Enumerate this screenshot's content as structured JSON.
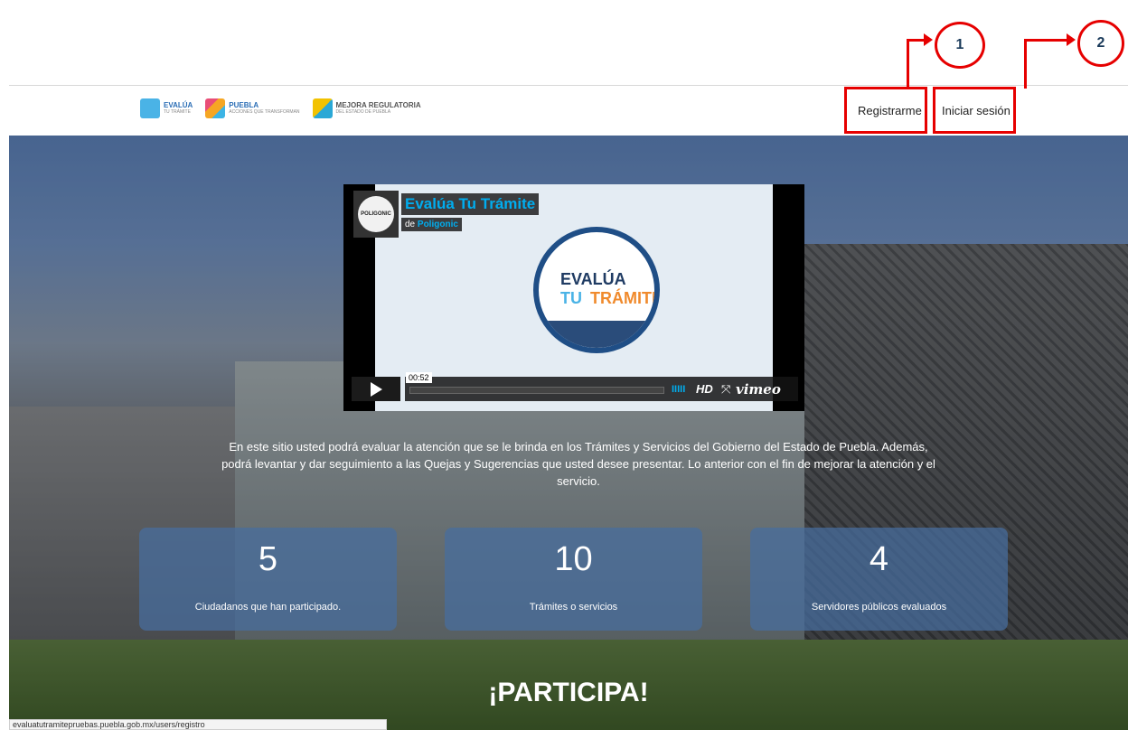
{
  "header": {
    "logos": [
      {
        "name": "evalua-tu-tramite",
        "line1": "EVALÚA",
        "line2": "TU TRÁMITE"
      },
      {
        "name": "puebla",
        "line1": "PUEBLA",
        "line2": "ACCIONES QUE TRANSFORMAN"
      },
      {
        "name": "mejora-regulatoria",
        "line1": "MEJORA REGULATORIA",
        "line2": "DEL ESTADO DE PUEBLA"
      }
    ],
    "nav": {
      "register_label": "Registrarme",
      "login_label": "Iniciar sesión"
    }
  },
  "annotations": {
    "marker1": "1",
    "marker2": "2",
    "color": "#e60000"
  },
  "video": {
    "title": "Evalúa Tu Trámite",
    "by_prefix": "de",
    "by_author": "Poligonic",
    "avatar_text": "POLIGONIC",
    "badge_line1": "EVALÚA",
    "badge_line2a": "TU",
    "badge_line2b": "TRÁMITE",
    "time": "00:52",
    "hd_label": "HD",
    "brand": "vimeo",
    "accent_color": "#00adef"
  },
  "intro_text": "En este sitio usted podrá evaluar la atención que se le brinda en los Trámites y Servicios del Gobierno del Estado de Puebla. Además, podrá levantar y dar seguimiento a las Quejas y Sugerencias que usted desee presentar. Lo anterior con el fin de mejorar la atención y el servicio.",
  "stats": [
    {
      "value": "5",
      "label": "Ciudadanos que han participado."
    },
    {
      "value": "10",
      "label": "Trámites o servicios"
    },
    {
      "value": "4",
      "label": "Servidores públicos evaluados"
    }
  ],
  "cta": "¡PARTICIPA!",
  "status_bar_url": "evaluatutramitepruebas.puebla.gob.mx/users/registro"
}
